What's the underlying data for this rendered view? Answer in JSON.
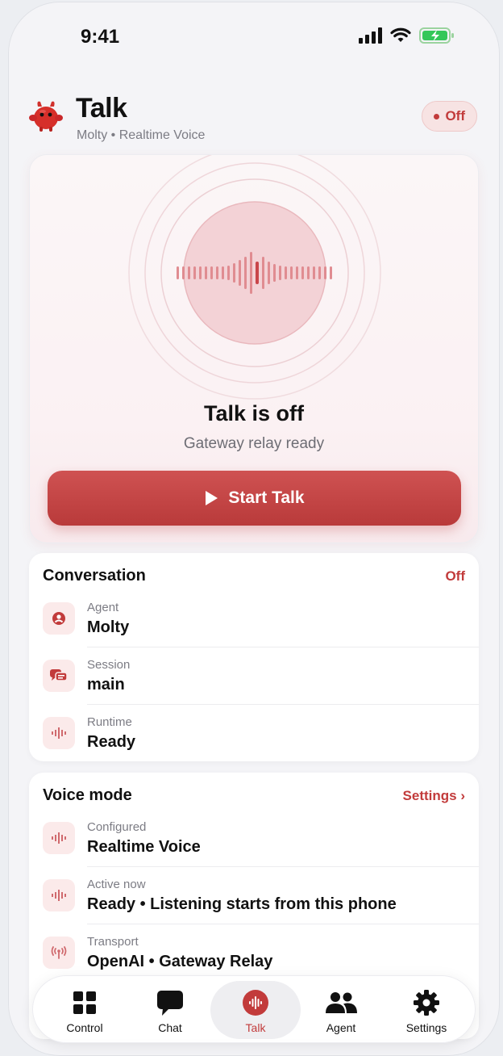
{
  "status_bar": {
    "time": "9:41"
  },
  "header": {
    "title": "Talk",
    "subtitle": "Molty • Realtime Voice",
    "status_pill": "Off"
  },
  "hero": {
    "title": "Talk is off",
    "subtitle": "Gateway relay ready",
    "start_label": "Start Talk"
  },
  "conversation": {
    "title": "Conversation",
    "status": "Off",
    "rows": [
      {
        "label": "Agent",
        "value": "Molty",
        "icon": "person-icon"
      },
      {
        "label": "Session",
        "value": "main",
        "icon": "chat-bubbles-icon"
      },
      {
        "label": "Runtime",
        "value": "Ready",
        "icon": "waveform-icon"
      }
    ]
  },
  "voice_mode": {
    "title": "Voice mode",
    "action": "Settings ›",
    "rows": [
      {
        "label": "Configured",
        "value": "Realtime Voice",
        "icon": "waveform-icon"
      },
      {
        "label": "Active now",
        "value": "Ready • Listening starts from this phone",
        "icon": "waveform-icon"
      },
      {
        "label": "Transport",
        "value": "OpenAI • Gateway Relay",
        "icon": "antenna-icon"
      }
    ]
  },
  "tabs": [
    {
      "label": "Control",
      "icon": "grid-icon"
    },
    {
      "label": "Chat",
      "icon": "chat-icon"
    },
    {
      "label": "Talk",
      "icon": "talk-waveform-icon",
      "active": true
    },
    {
      "label": "Agent",
      "icon": "people-icon"
    },
    {
      "label": "Settings",
      "icon": "gear-icon"
    }
  ],
  "colors": {
    "accent": "#c23b3b",
    "accent_light": "#fbeaea"
  }
}
